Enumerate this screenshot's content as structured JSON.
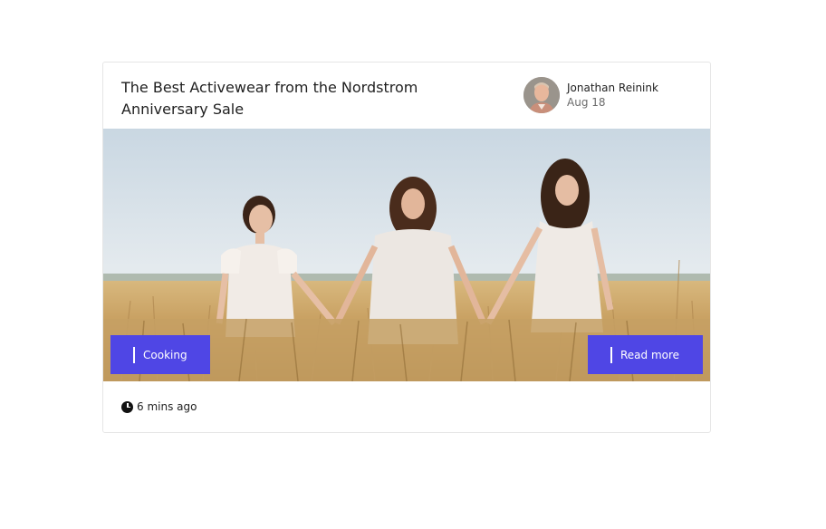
{
  "card": {
    "title": "The Best Activewear from the Nordstrom Anniversary Sale",
    "author_name": "Jonathan Reinink",
    "date": "Aug 18",
    "category_label": "Cooking",
    "read_more_label": "Read more",
    "time_ago": "6 mins ago"
  },
  "icons": {
    "avatar": "author-avatar",
    "clock": "clock-icon"
  },
  "colors": {
    "accent": "#4f46e5"
  }
}
